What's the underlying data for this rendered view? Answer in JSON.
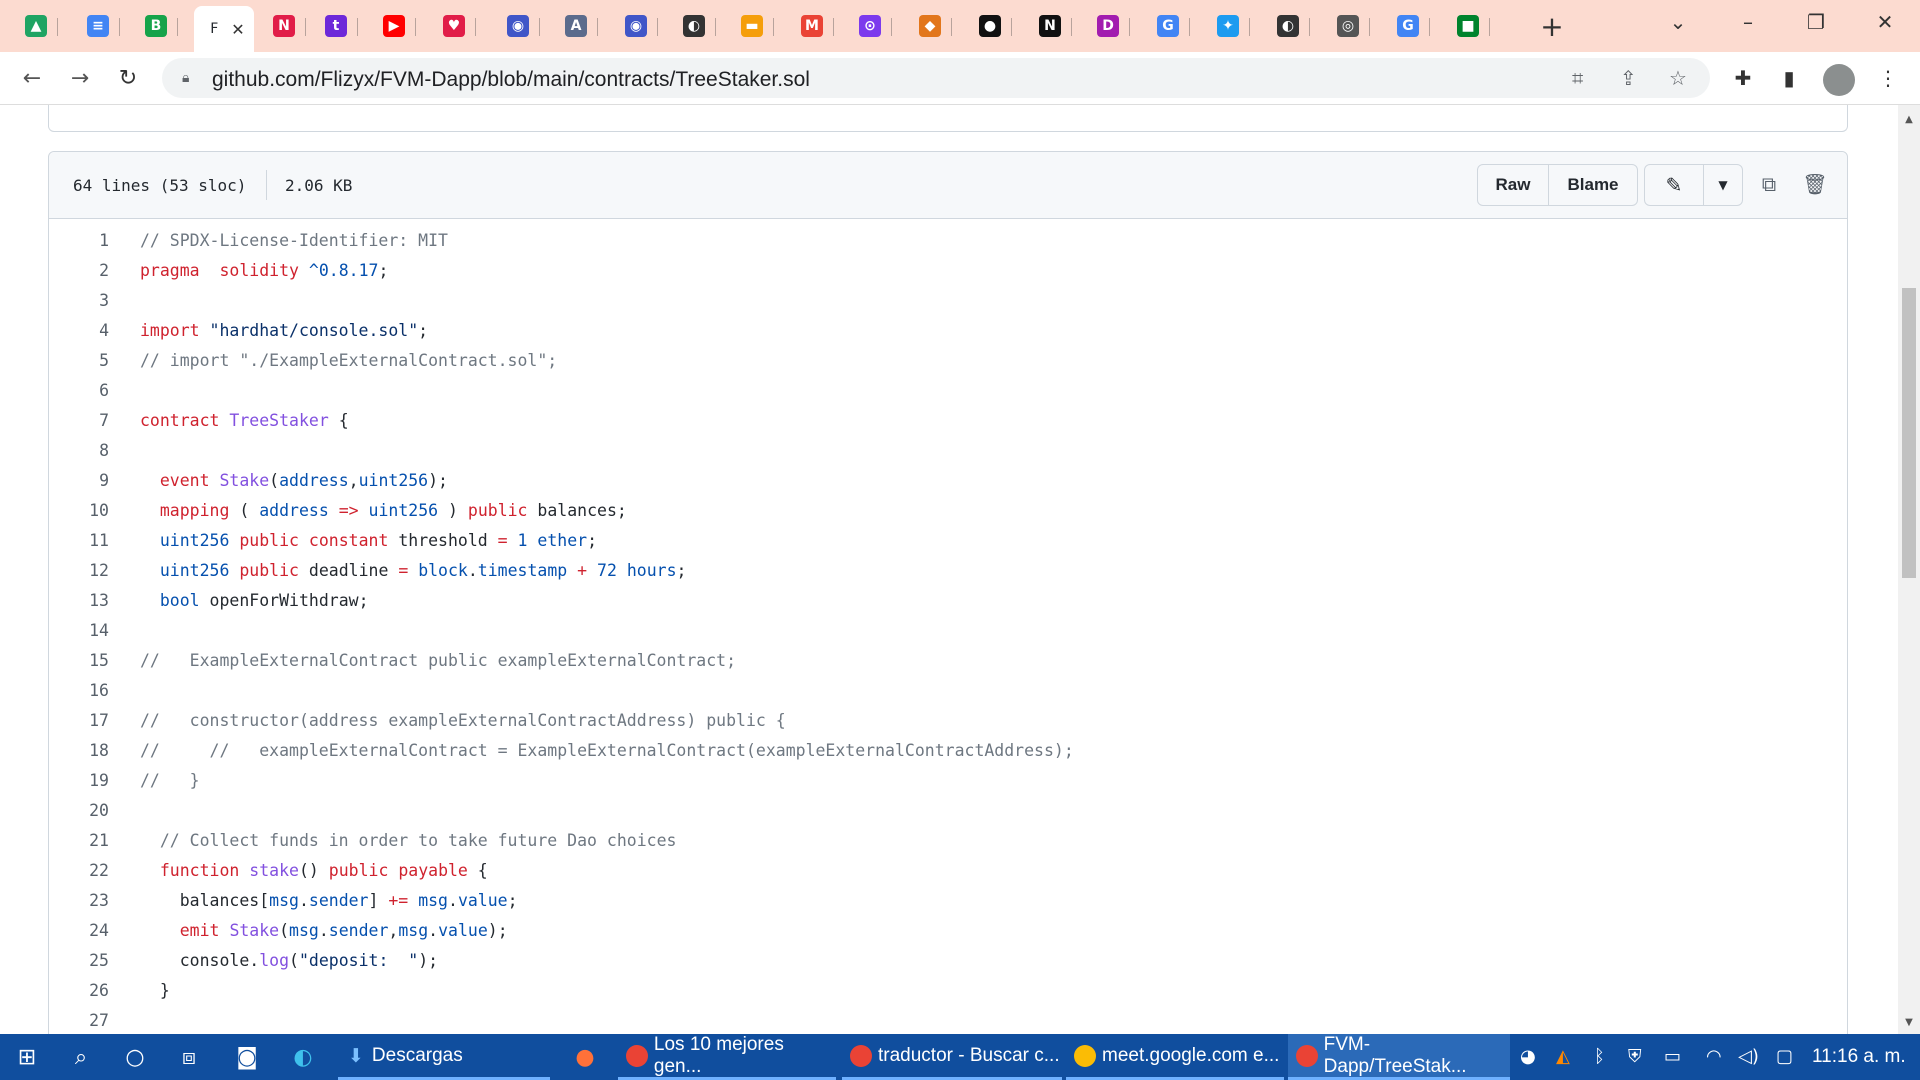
{
  "browser": {
    "tabs": [
      {
        "name": "drive",
        "glyph": "▲",
        "color": "#1fa463"
      },
      {
        "name": "docs",
        "glyph": "≡",
        "color": "#4285f4"
      },
      {
        "name": "coin",
        "glyph": "B",
        "color": "#16a34a"
      },
      {
        "name": "github-active",
        "glyph": "F",
        "color": "#ffffff"
      },
      {
        "name": "notion-red",
        "glyph": "N",
        "color": "#e11d48"
      },
      {
        "name": "twitch",
        "glyph": "t",
        "color": "#6d28d9"
      },
      {
        "name": "youtube",
        "glyph": "▶",
        "color": "#ff0000"
      },
      {
        "name": "heart",
        "glyph": "♥",
        "color": "#e11d48"
      },
      {
        "name": "chrome-red",
        "glyph": "◉",
        "color": "#4056c8"
      },
      {
        "name": "doc-a",
        "glyph": "A",
        "color": "#5b6b8c"
      },
      {
        "name": "chrome-red-2",
        "glyph": "◉",
        "color": "#4056c8"
      },
      {
        "name": "globe",
        "glyph": "◐",
        "color": "#333333"
      },
      {
        "name": "rainbow",
        "glyph": "▬",
        "color": "#f59e0b"
      },
      {
        "name": "gmail",
        "glyph": "M",
        "color": "#ea4335"
      },
      {
        "name": "compass",
        "glyph": "⊙",
        "color": "#7c3aed"
      },
      {
        "name": "metamask",
        "glyph": "◆",
        "color": "#e2761b"
      },
      {
        "name": "github",
        "glyph": "●",
        "color": "#111111"
      },
      {
        "name": "notion",
        "glyph": "N",
        "color": "#111111"
      },
      {
        "name": "d-app",
        "glyph": "D",
        "color": "#a21caf"
      },
      {
        "name": "google",
        "glyph": "G",
        "color": "#4285f4"
      },
      {
        "name": "twitter",
        "glyph": "✦",
        "color": "#1d9bf0"
      },
      {
        "name": "globe-2",
        "glyph": "◐",
        "color": "#333333"
      },
      {
        "name": "chrome",
        "glyph": "◎",
        "color": "#555555"
      },
      {
        "name": "google-2",
        "glyph": "G",
        "color": "#4285f4"
      },
      {
        "name": "meet",
        "glyph": "■",
        "color": "#00832d"
      }
    ],
    "active_tab_label": "F",
    "new_tab": "+",
    "url": "github.com/Flizyx/FVM-Dapp/blob/main/contracts/TreeStaker.sol"
  },
  "file": {
    "lines_info": "64 lines (53 sloc)",
    "size": "2.06 KB",
    "raw_label": "Raw",
    "blame_label": "Blame"
  },
  "code_lines": [
    [
      [
        "c",
        "// SPDX-License-Identifier: MIT"
      ]
    ],
    [
      [
        "k",
        "pragma"
      ],
      [
        "",
        "  "
      ],
      [
        "k",
        "solidity"
      ],
      [
        "",
        " "
      ],
      [
        "e",
        "^0.8.17"
      ],
      [
        "",
        ";"
      ]
    ],
    [],
    [
      [
        "k",
        "import"
      ],
      [
        "",
        " "
      ],
      [
        "s",
        "\"hardhat/console.sol\""
      ],
      [
        "",
        ";"
      ]
    ],
    [
      [
        "c",
        "// import \"./ExampleExternalContract.sol\";"
      ]
    ],
    [],
    [
      [
        "k",
        "contract"
      ],
      [
        "",
        " "
      ],
      [
        "f",
        "TreeStaker"
      ],
      [
        "",
        " {"
      ]
    ],
    [],
    [
      [
        "",
        "  "
      ],
      [
        "k",
        "event"
      ],
      [
        "",
        " "
      ],
      [
        "f",
        "Stake"
      ],
      [
        "",
        "("
      ],
      [
        "e",
        "address"
      ],
      [
        "",
        ","
      ],
      [
        "e",
        "uint256"
      ],
      [
        "",
        ");"
      ]
    ],
    [
      [
        "",
        "  "
      ],
      [
        "k",
        "mapping"
      ],
      [
        "",
        " ( "
      ],
      [
        "e",
        "address"
      ],
      [
        "",
        " "
      ],
      [
        "k",
        "=>"
      ],
      [
        "",
        " "
      ],
      [
        "e",
        "uint256"
      ],
      [
        "",
        " ) "
      ],
      [
        "k",
        "public"
      ],
      [
        "",
        " balances;"
      ]
    ],
    [
      [
        "",
        "  "
      ],
      [
        "e",
        "uint256"
      ],
      [
        "",
        " "
      ],
      [
        "k",
        "public"
      ],
      [
        "",
        " "
      ],
      [
        "k",
        "constant"
      ],
      [
        "",
        " threshold "
      ],
      [
        "k",
        "="
      ],
      [
        "",
        " "
      ],
      [
        "e",
        "1"
      ],
      [
        "",
        " "
      ],
      [
        "e",
        "ether"
      ],
      [
        "",
        ";"
      ]
    ],
    [
      [
        "",
        "  "
      ],
      [
        "e",
        "uint256"
      ],
      [
        "",
        " "
      ],
      [
        "k",
        "public"
      ],
      [
        "",
        " deadline "
      ],
      [
        "k",
        "="
      ],
      [
        "",
        " "
      ],
      [
        "e",
        "block"
      ],
      [
        "",
        "."
      ],
      [
        "e",
        "timestamp"
      ],
      [
        "",
        " "
      ],
      [
        "k",
        "+"
      ],
      [
        "",
        " "
      ],
      [
        "e",
        "72"
      ],
      [
        "",
        " "
      ],
      [
        "e",
        "hours"
      ],
      [
        "",
        ";"
      ]
    ],
    [
      [
        "",
        "  "
      ],
      [
        "e",
        "bool"
      ],
      [
        "",
        " openForWithdraw;"
      ]
    ],
    [],
    [
      [
        "c",
        "//   ExampleExternalContract public exampleExternalContract;"
      ]
    ],
    [],
    [
      [
        "c",
        "//   constructor(address exampleExternalContractAddress) public {"
      ]
    ],
    [
      [
        "c",
        "//     //   exampleExternalContract = ExampleExternalContract(exampleExternalContractAddress);"
      ]
    ],
    [
      [
        "c",
        "//   }"
      ]
    ],
    [],
    [
      [
        "",
        "  "
      ],
      [
        "c",
        "// Collect funds in order to take future Dao choices"
      ]
    ],
    [
      [
        "",
        "  "
      ],
      [
        "k",
        "function"
      ],
      [
        "",
        " "
      ],
      [
        "f",
        "stake"
      ],
      [
        "",
        "() "
      ],
      [
        "k",
        "public"
      ],
      [
        "",
        " "
      ],
      [
        "k",
        "payable"
      ],
      [
        "",
        " {"
      ]
    ],
    [
      [
        "",
        "    balances["
      ],
      [
        "e",
        "msg"
      ],
      [
        "",
        "."
      ],
      [
        "e",
        "sender"
      ],
      [
        "",
        "] "
      ],
      [
        "k",
        "+="
      ],
      [
        "",
        " "
      ],
      [
        "e",
        "msg"
      ],
      [
        "",
        "."
      ],
      [
        "e",
        "value"
      ],
      [
        "",
        ";"
      ]
    ],
    [
      [
        "",
        "    "
      ],
      [
        "k",
        "emit"
      ],
      [
        "",
        " "
      ],
      [
        "f",
        "Stake"
      ],
      [
        "",
        "("
      ],
      [
        "e",
        "msg"
      ],
      [
        "",
        "."
      ],
      [
        "e",
        "sender"
      ],
      [
        "",
        ","
      ],
      [
        "e",
        "msg"
      ],
      [
        "",
        "."
      ],
      [
        "e",
        "value"
      ],
      [
        "",
        ");"
      ]
    ],
    [
      [
        "",
        "    console."
      ],
      [
        "f",
        "log"
      ],
      [
        "",
        "("
      ],
      [
        "s",
        "\"deposit:  \""
      ],
      [
        "",
        ");"
      ]
    ],
    [
      [
        "",
        "  }"
      ]
    ],
    []
  ],
  "taskbar": {
    "apps": [
      {
        "name": "taskbar-descargas",
        "label": "Descargas",
        "icon_color": "#3b82f6"
      },
      {
        "name": "taskbar-firefox",
        "label": "",
        "icon_color": "#ff7139"
      },
      {
        "name": "taskbar-chrome-1",
        "label": "Los 10 mejores gen...",
        "icon_color": "#ea4335"
      },
      {
        "name": "taskbar-chrome-2",
        "label": "traductor - Buscar c...",
        "icon_color": "#ea4335"
      },
      {
        "name": "taskbar-chrome-3",
        "label": "meet.google.com e...",
        "icon_color": "#fbbc05"
      },
      {
        "name": "taskbar-chrome-4",
        "label": "FVM-Dapp/TreeStak...",
        "icon_color": "#ea4335"
      }
    ],
    "time": "11:16 a. m."
  }
}
